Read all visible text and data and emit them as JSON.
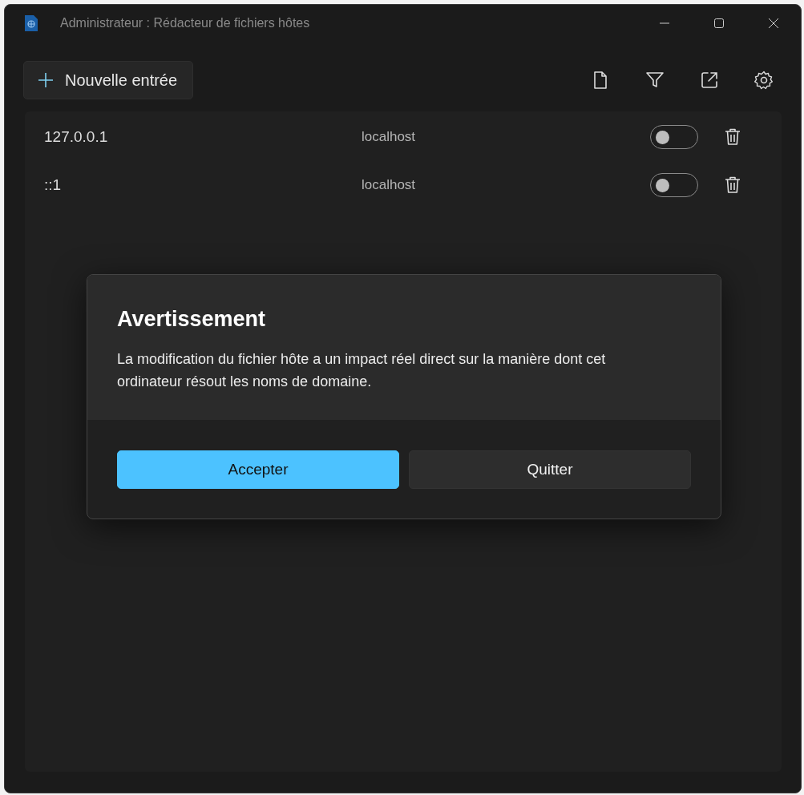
{
  "window": {
    "title": "Administrateur : Rédacteur de fichiers hôtes"
  },
  "toolbar": {
    "new_entry_button": "Nouvelle entrée"
  },
  "entries": [
    {
      "address": "127.0.0.1",
      "hosts": "localhost",
      "on": false
    },
    {
      "address": "::1",
      "hosts": "localhost",
      "on": false
    }
  ],
  "dialog": {
    "title": "Avertissement",
    "message": "La modification du fichier hôte a un impact réel direct sur la manière dont cet ordinateur résout les noms de domaine.",
    "buttons": [
      {
        "label": "Accepter",
        "kind": "primary"
      },
      {
        "label": "Quitter",
        "kind": "secondary"
      }
    ]
  }
}
